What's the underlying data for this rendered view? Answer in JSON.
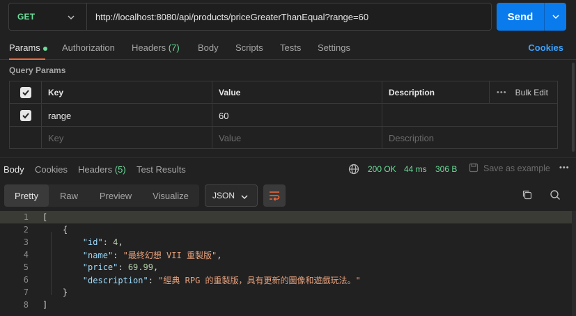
{
  "request": {
    "method": "GET",
    "url": "http://localhost:8080/api/products/priceGreaterThanEqual?range=60",
    "send_label": "Send"
  },
  "request_tabs": {
    "params": "Params",
    "authorization": "Authorization",
    "headers": "Headers",
    "headers_count": "(7)",
    "body": "Body",
    "scripts": "Scripts",
    "tests": "Tests",
    "settings": "Settings",
    "cookies": "Cookies"
  },
  "query_params": {
    "label": "Query Params",
    "columns": [
      "Key",
      "Value",
      "Description"
    ],
    "bulk_edit": "Bulk Edit",
    "rows": [
      {
        "key": "range",
        "value": "60",
        "description": "",
        "checked": true
      }
    ],
    "placeholder": {
      "key": "Key",
      "value": "Value",
      "description": "Description"
    }
  },
  "response_tabs": {
    "body": "Body",
    "cookies": "Cookies",
    "headers": "Headers",
    "headers_count": "(5)",
    "test_results": "Test Results",
    "status": "200 OK",
    "time": "44 ms",
    "size": "306 B",
    "save_example": "Save as example"
  },
  "response_view": {
    "modes": [
      "Pretty",
      "Raw",
      "Preview",
      "Visualize"
    ],
    "active_mode": "Pretty",
    "format": "JSON"
  },
  "code": {
    "line_numbers": [
      "1",
      "2",
      "3",
      "4",
      "5",
      "6",
      "7",
      "8"
    ],
    "id_key": "\"id\"",
    "id_val": "4",
    "name_key": "\"name\"",
    "name_val": "\"最終幻想 VII 重製版\"",
    "price_key": "\"price\"",
    "price_val": "69.99",
    "desc_key": "\"description\"",
    "desc_val": "\"經典 RPG 的重製版，具有更新的圖像和遊戲玩法。\""
  },
  "colors": {
    "accent": "#f26b3a",
    "primary_button": "#097bed",
    "success": "#6bdd9a",
    "link": "#3da3ff"
  }
}
